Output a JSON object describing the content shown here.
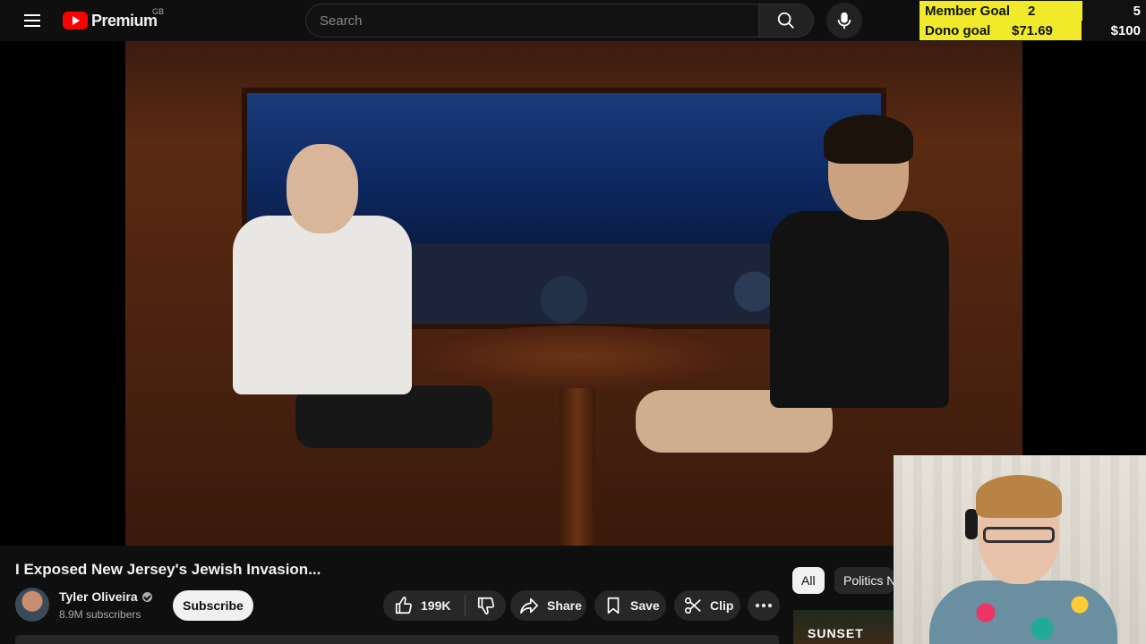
{
  "header": {
    "logo_text": "Premium",
    "country_code": "GB",
    "search_placeholder": "Search"
  },
  "overlay_goals": {
    "member_goal": {
      "label": "Member Goal",
      "current": "2",
      "target": "5",
      "progress": 0.4
    },
    "dono_goal": {
      "label": "Dono goal",
      "current": "$71.69",
      "target": "$100",
      "progress": 0.7169
    }
  },
  "video": {
    "title": "I Exposed New Jersey's Jewish Invasion..."
  },
  "channel": {
    "name": "Tyler Oliveira",
    "subscribers": "8.9M subscribers",
    "subscribe_label": "Subscribe"
  },
  "actions": {
    "like_count": "199K",
    "share_label": "Share",
    "save_label": "Save",
    "clip_label": "Clip"
  },
  "chips": {
    "all_label": "All",
    "politics_label": "Politics N"
  },
  "recommendation": {
    "thumb_text": "SUNSET"
  },
  "icons": {
    "menu": "menu-icon",
    "search": "search-icon",
    "mic": "mic-icon",
    "like": "thumbs-up-icon",
    "dislike": "thumbs-down-icon",
    "share": "share-arrow-icon",
    "save": "bookmark-icon",
    "clip": "scissors-icon",
    "more": "more-horizontal-icon",
    "verified": "verified-check-icon"
  }
}
